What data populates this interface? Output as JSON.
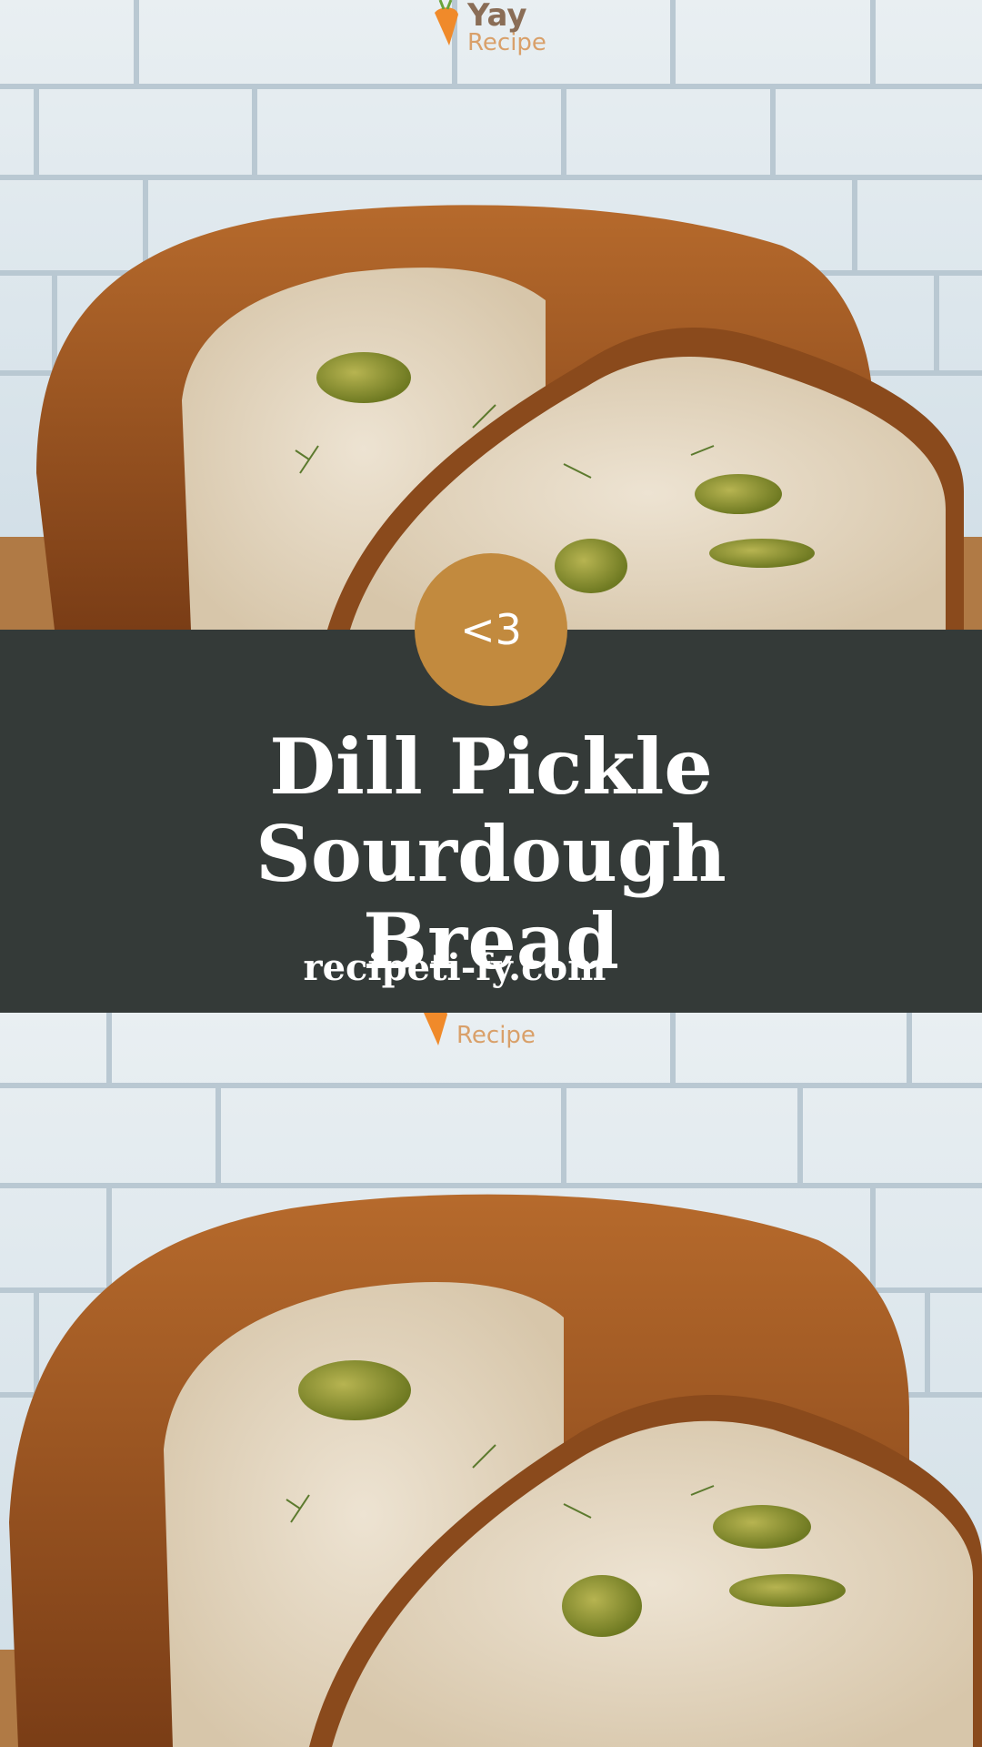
{
  "badge": {
    "label": "<3"
  },
  "title": {
    "line1": "Dill Pickle Sourdough",
    "line2": "Bread"
  },
  "site": {
    "label": "recipeti-fy.com"
  },
  "logo": {
    "line1": "Yay",
    "line2": "Recipe"
  },
  "colors": {
    "band": "#343a38",
    "badge": "#c28a3e",
    "text": "#ffffff"
  },
  "images": {
    "top": "dill-pickle-sourdough-bread-photo",
    "bottom": "dill-pickle-sourdough-bread-photo"
  }
}
